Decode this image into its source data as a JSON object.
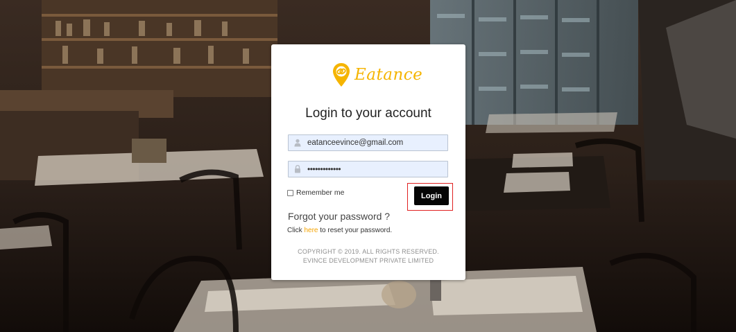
{
  "brand": {
    "name": "Eatance",
    "logo_icon": "map-pin-link-icon",
    "accent_color": "#f5b400"
  },
  "login_form": {
    "title": "Login to your account",
    "email": {
      "value": "eatanceevince@gmail.com",
      "icon": "user-icon"
    },
    "password": {
      "value": "•••••••••••••",
      "icon": "lock-icon"
    },
    "remember_me": {
      "label": "Remember me",
      "checked": false
    },
    "login_button_label": "Login",
    "highlight_color": "#e02020"
  },
  "forgot_password": {
    "title": "Forgot your password ?",
    "prefix": "Click ",
    "link_text": "here",
    "suffix": " to reset your password."
  },
  "footer": {
    "copyright_line1": "COPYRIGHT © 2019. ALL RIGHTS RESERVED.",
    "copyright_line2": "EVINCE DEVELOPMENT PRIVATE LIMITED"
  },
  "background": {
    "description_icon": "restaurant-interior-photo"
  }
}
